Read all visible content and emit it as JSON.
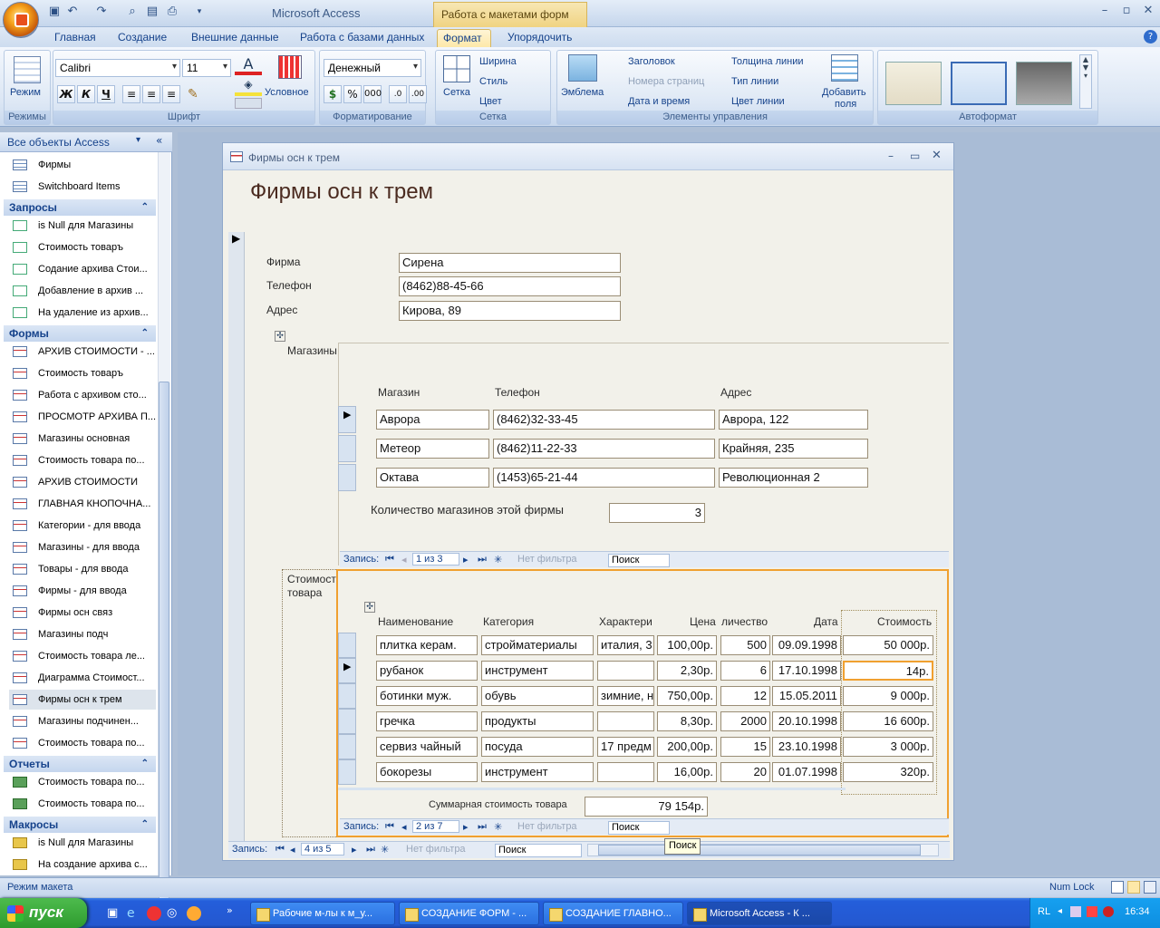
{
  "app": {
    "title": "Microsoft Access",
    "context_title": "Работа с макетами форм"
  },
  "ribbon": {
    "tabs": [
      "Главная",
      "Создание",
      "Внешние данные",
      "Работа с базами данных",
      "Формат",
      "Упорядочить"
    ],
    "active_tab": "Формат",
    "groups": {
      "modes": {
        "label": "Режимы",
        "mode_button": "Режим"
      },
      "font": {
        "label": "Шрифт",
        "font_name": "Calibri",
        "font_size": "11",
        "bold": "Ж",
        "italic": "К",
        "underline": "Ч",
        "conditional": "Условное"
      },
      "formatting": {
        "label": "Форматирование",
        "format_value": "Денежный",
        "percent": "%",
        "thousands": "000"
      },
      "grid": {
        "label": "Сетка",
        "grid_button": "Сетка",
        "width": "Ширина",
        "style": "Стиль",
        "color": "Цвет"
      },
      "controls": {
        "label": "Элементы управления",
        "logo": "Эмблема",
        "heading": "Заголовок",
        "page_numbers": "Номера страниц",
        "date_time": "Дата и время",
        "line_width": "Толщина линии",
        "line_type": "Тип линии",
        "line_color": "Цвет линии",
        "add_field_1": "Добавить",
        "add_field_2": "поля"
      },
      "autoformat": {
        "label": "Автоформат"
      }
    }
  },
  "nav": {
    "header": "Все объекты Access",
    "tables": [
      "Фирмы",
      "Switchboard Items"
    ],
    "queries_label": "Запросы",
    "queries": [
      "is Null для Магазины",
      "Стоимость товаръ",
      "Содание архива Стои...",
      "Добавление в архив ...",
      "На удаление из архив..."
    ],
    "forms_label": "Формы",
    "forms": [
      "АРХИВ СТОИМОСТИ - ...",
      "Стоимость товаръ",
      "Работа с архивом сто...",
      "ПРОСМОТР АРХИВА П...",
      "Магазины основная",
      "Стоимость товара по...",
      "АРХИВ СТОИМОСТИ",
      "ГЛАВНАЯ КНОПОЧНА...",
      "Категории - для ввода",
      "Магазины - для ввода",
      "Товары - для ввода",
      "Фирмы - для ввода",
      "Фирмы осн связ",
      "Магазины подч",
      "Стоимость товара ле...",
      "Диаграмма Стоимост...",
      "Фирмы осн к трем",
      "Магазины подчинен...",
      "Стоимость товара по..."
    ],
    "selected_form": "Фирмы осн к трем",
    "reports_label": "Отчеты",
    "reports": [
      "Стоимость товара по...",
      "Стоимость товара по..."
    ],
    "macros_label": "Макросы",
    "macros": [
      "is Null для Магазины",
      "На создание архива с..."
    ]
  },
  "form": {
    "window_title": "Фирмы осн к трем",
    "heading": "Фирмы осн к трем",
    "firm": {
      "label": "Фирма",
      "value": "Сирена"
    },
    "phone": {
      "label": "Телефон",
      "value": "(8462)88-45-66"
    },
    "address": {
      "label": "Адрес",
      "value": "Кирова, 89"
    },
    "shops_label": "Магазины",
    "shops_headers": [
      "Магазин",
      "Телефон",
      "Адрес"
    ],
    "shops": [
      [
        "Аврора",
        "(8462)32-33-45",
        "Аврора, 122"
      ],
      [
        "Метеор",
        "(8462)11-22-33",
        "Крайняя, 235"
      ],
      [
        "Октава",
        "(1453)65-21-44",
        "Революционная 2"
      ]
    ],
    "shops_count_label": "Количество магазинов этой фирмы",
    "shops_count": "3",
    "shops_nav": {
      "record": "Запись:",
      "pos": "1 из 3",
      "filter": "Нет фильтра",
      "search": "Поиск"
    },
    "goods_label": "Стоимость товара",
    "goods_headers": [
      "Наименование",
      "Категория",
      "Характери",
      "Цена",
      "личество",
      "Дата",
      "Стоимость"
    ],
    "goods": [
      [
        "плитка керам.",
        "стройматериалы",
        "италия, 3",
        "100,00р.",
        "500",
        "09.09.1998",
        "50 000р."
      ],
      [
        "рубанок",
        "инструмент",
        "",
        "2,30р.",
        "6",
        "17.10.1998",
        "14р."
      ],
      [
        "ботинки муж.",
        "обувь",
        "зимние, н",
        "750,00р.",
        "12",
        "15.05.2011",
        "9 000р."
      ],
      [
        "гречка",
        "продукты",
        "",
        "8,30р.",
        "2000",
        "20.10.1998",
        "16 600р."
      ],
      [
        "сервиз чайный",
        "посуда",
        "17 предм",
        "200,00р.",
        "15",
        "23.10.1998",
        "3 000р."
      ],
      [
        "бокорезы",
        "инструмент",
        "",
        "16,00р.",
        "20",
        "01.07.1998",
        "320р."
      ]
    ],
    "goods_total_label": "Суммарная стоимость товара",
    "goods_total": "79 154р.",
    "goods_nav": {
      "record": "Запись:",
      "pos": "2 из 7",
      "filter": "Нет фильтра",
      "search": "Поиск"
    },
    "main_nav": {
      "record": "Запись:",
      "pos": "4 из 5",
      "filter": "Нет фильтра",
      "search": "Поиск"
    },
    "tooltip": "Поиск"
  },
  "status": {
    "left": "Режим макета",
    "numlock": "Num Lock"
  },
  "taskbar": {
    "start": "пуск",
    "tasks": [
      "Рабочие м-лы к м_у...",
      "СОЗДАНИЕ ФОРМ - ...",
      "СОЗДАНИЕ ГЛАВНО...",
      "Microsoft Access - К ..."
    ],
    "lang": "RL",
    "clock": "16:34"
  }
}
